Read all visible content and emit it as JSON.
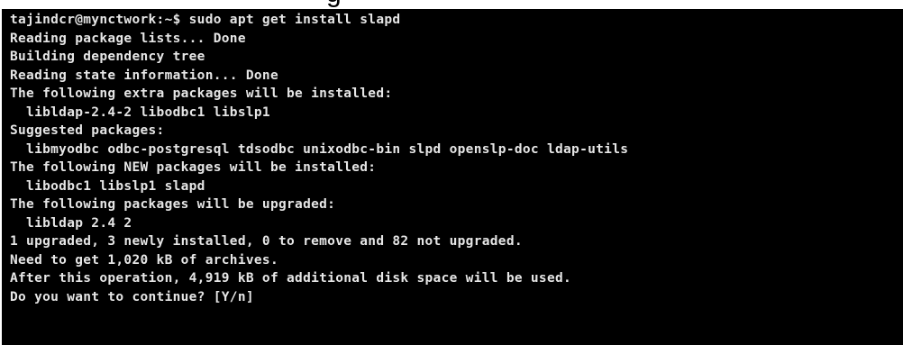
{
  "caption": {
    "text": "g"
  },
  "terminal": {
    "lines": [
      "tajindcr@mynctwork:~$ sudo apt get install slapd",
      "Reading package lists... Done",
      "Building dependency tree",
      "Reading state information... Done",
      "The following extra packages will be installed:",
      "  libldap-2.4-2 libodbc1 libslp1",
      "Suggested packages:",
      "  libmyodbc odbc-postgresql tdsodbc unixodbc-bin slpd openslp-doc ldap-utils",
      "The following NEW packages will be installed:",
      "  libodbc1 libslp1 slapd",
      "The following packages will be upgraded:",
      "  libldap 2.4 2",
      "1 upgraded, 3 newly installed, 0 to remove and 82 not upgraded.",
      "Need to get 1,020 kB of archives.",
      "After this operation, 4,919 kB of additional disk space will be used.",
      "Do you want to continue? [Y/n]"
    ]
  },
  "colors": {
    "background": "#000000",
    "text": "#e6e6e6"
  }
}
